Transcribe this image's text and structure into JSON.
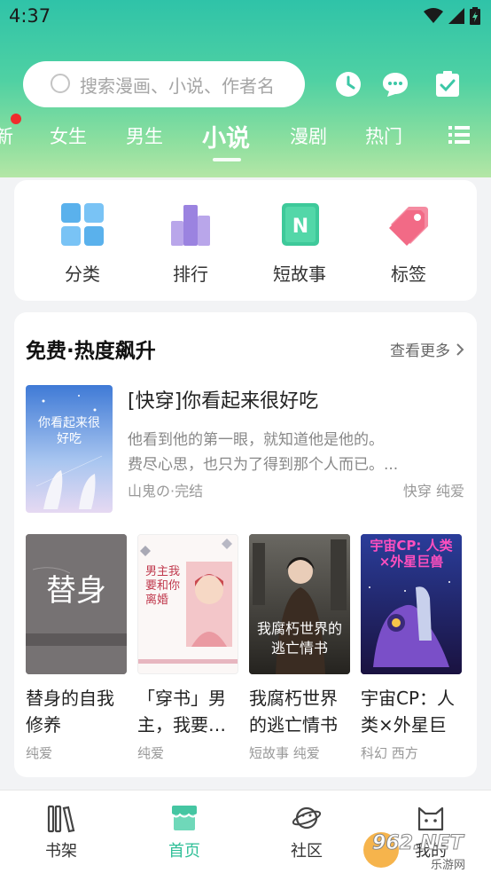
{
  "status": {
    "time": "4:37"
  },
  "search": {
    "placeholder": "搜索漫画、小说、作者名"
  },
  "tabs": [
    {
      "label": "新"
    },
    {
      "label": "女生"
    },
    {
      "label": "男生"
    },
    {
      "label": "小说",
      "active": true
    },
    {
      "label": "漫剧"
    },
    {
      "label": "热门"
    }
  ],
  "quick": [
    {
      "label": "分类",
      "icon": "grid-icon"
    },
    {
      "label": "排行",
      "icon": "bar-chart-icon"
    },
    {
      "label": "短故事",
      "icon": "n-book-icon"
    },
    {
      "label": "标签",
      "icon": "tag-icon"
    }
  ],
  "section": {
    "title": "免费·热度飙升",
    "more": "查看更多"
  },
  "highlight": {
    "title": "[快穿]你看起来很好吃",
    "desc_line1": "他看到他的第一眼，就知道他是他的。",
    "desc_line2": "费尽心思，也只为了得到那个人而已。...",
    "author": "山鬼の·完结",
    "tags": "快穿 纯爱",
    "cover_text": "你看起来很好吃"
  },
  "books": [
    {
      "title": "替身的自我修养",
      "tags": "纯爱",
      "cover_text": "替身"
    },
    {
      "title": "「穿书」男主，我要…",
      "tags": "纯爱",
      "cover_text": "男主我要和你离婚"
    },
    {
      "title": "我腐朽世界的逃亡情书",
      "tags": "短故事 纯爱",
      "cover_text": "我腐朽世界的逃亡情书"
    },
    {
      "title": "宇宙CP：人类×外星巨兽",
      "tags": "科幻 西方",
      "cover_text": "宇宙CP: 人类×外星巨兽"
    }
  ],
  "nav": [
    {
      "label": "书架",
      "icon": "bookshelf-icon"
    },
    {
      "label": "首页",
      "icon": "shop-icon",
      "active": true
    },
    {
      "label": "社区",
      "icon": "planet-icon"
    },
    {
      "label": "我的",
      "icon": "cat-icon"
    }
  ],
  "watermark": {
    "text": "962.NET",
    "sub": "乐游网"
  },
  "colors": {
    "accent": "#2fbf97",
    "header_top": "#2fc3a8",
    "header_bottom": "#b4e6a6"
  }
}
